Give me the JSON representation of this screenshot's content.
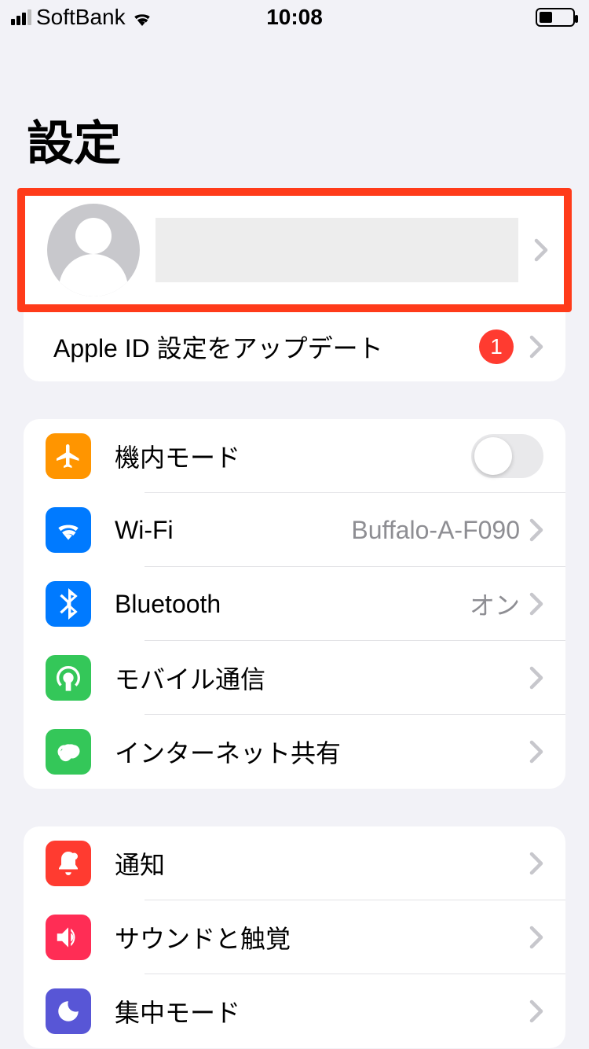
{
  "status": {
    "carrier": "SoftBank",
    "time": "10:08"
  },
  "title": "設定",
  "apple_id_update": {
    "label": "Apple ID 設定をアップデート",
    "badge": "1"
  },
  "connectivity": {
    "airplane": {
      "label": "機内モード"
    },
    "wifi": {
      "label": "Wi-Fi",
      "value": "Buffalo-A-F090"
    },
    "bluetooth": {
      "label": "Bluetooth",
      "value": "オン"
    },
    "cellular": {
      "label": "モバイル通信"
    },
    "hotspot": {
      "label": "インターネット共有"
    }
  },
  "general": {
    "notifications": {
      "label": "通知"
    },
    "sounds": {
      "label": "サウンドと触覚"
    },
    "focus": {
      "label": "集中モード"
    }
  },
  "colors": {
    "airplane": "#ff9500",
    "wifi": "#007aff",
    "bluetooth": "#007aff",
    "cellular": "#34c759",
    "hotspot": "#34c759",
    "notifications": "#ff3b30",
    "sounds": "#ff2d55",
    "focus": "#5856d6"
  }
}
